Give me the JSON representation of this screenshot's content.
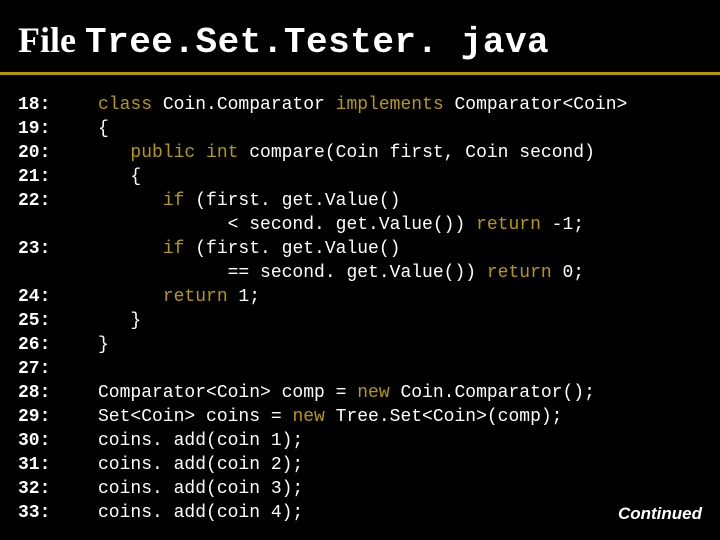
{
  "title": {
    "word": "File",
    "mono": "Tree.Set.Tester. java"
  },
  "gutter": [
    "18:",
    "19:",
    "20:",
    "21:",
    "22:",
    "",
    "23:",
    "",
    "24:",
    "25:",
    "26:",
    "27:",
    "28:",
    "29:",
    "30:",
    "31:",
    "32:",
    "33:"
  ],
  "code": {
    "l18_a": "class",
    "l18_b": " Coin.Comparator ",
    "l18_c": "implements",
    "l18_d": " Comparator<Coin>",
    "l19": "{",
    "l20_a": "   ",
    "l20_b": "public int",
    "l20_c": " compare(Coin first, Coin second)",
    "l21": "   {",
    "l22_a": "      ",
    "l22_b": "if",
    "l22_c": " (first. get.Value()",
    "l22d": "            < second. get.Value()) ",
    "l22e": "return",
    "l22f": " -1;",
    "l23_a": "      ",
    "l23_b": "if",
    "l23_c": " (first. get.Value()",
    "l23d": "            == second. get.Value()) ",
    "l23e": "return",
    "l23f": " 0;",
    "l24_a": "      ",
    "l24_b": "return",
    "l24_c": " 1;",
    "l25": "   }",
    "l26": "}",
    "l27": "",
    "l28_a": "Comparator<Coin> comp = ",
    "l28_b": "new",
    "l28_c": " Coin.Comparator();",
    "l29_a": "Set<Coin> coins = ",
    "l29_b": "new",
    "l29_c": " Tree.Set<Coin>(comp);",
    "l30": "coins. add(coin 1);",
    "l31": "coins. add(coin 2);",
    "l32": "coins. add(coin 3);",
    "l33": "coins. add(coin 4);"
  },
  "continued": "Continued"
}
